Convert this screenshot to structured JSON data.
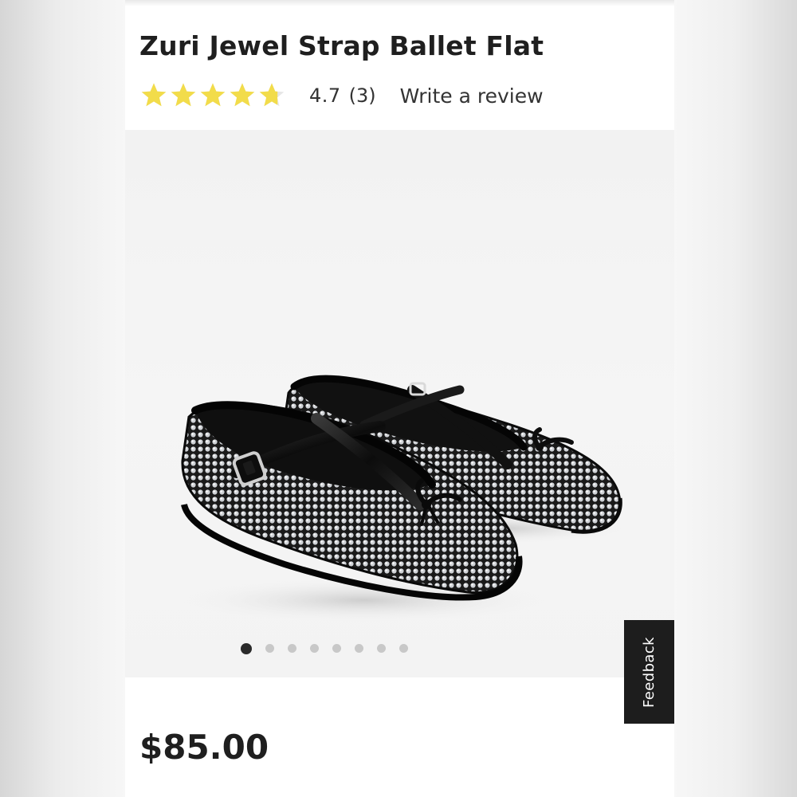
{
  "product": {
    "title": "Zuri Jewel Strap Ballet Flat",
    "rating": {
      "value_text": "4.7",
      "count_text": "(3)",
      "stars_value": 4.7,
      "stars_max": 5,
      "star_color": "#f2dc4a",
      "empty_star_color": "#e6e6e6"
    },
    "write_review_label": "Write a review",
    "price": "$85.00"
  },
  "gallery": {
    "image_icon": "product-photo-ballet-flats",
    "slide_count": 8,
    "active_slide": 1
  },
  "feedback": {
    "label": "Feedback",
    "background": "#1d1d1d"
  }
}
